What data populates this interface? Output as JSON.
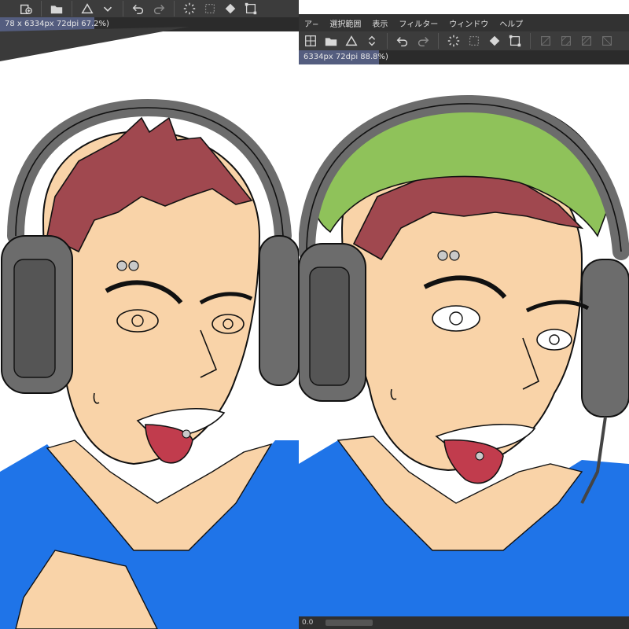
{
  "colors": {
    "hair": "#a0484f",
    "skin": "#f9d3a8",
    "shirt": "#1f74e8",
    "bandana": "#8fc25a",
    "headphones": "#6c6c6c",
    "tongue": "#c13c4d",
    "ui_dark": "#3c3c3c",
    "tab_active": "#545d7f"
  },
  "left_window": {
    "tab_label": "78 x 6334px 72dpi 67.2%)",
    "toolbar_icons": [
      "new-layer-icon",
      "folder-open-icon",
      "triangle-icon",
      "chevron-down-icon",
      "undo-icon",
      "redo-icon",
      "spinner-icon",
      "grid-icon",
      "fill-icon",
      "transform-icon"
    ]
  },
  "right_window": {
    "menu_items": [
      "ア−",
      "選択範囲",
      "表示",
      "フィルター",
      "ウィンドウ",
      "ヘルプ"
    ],
    "tab_label": "6334px 72dpi 88.8%)",
    "toolbar_icons": [
      "grid-icon",
      "folder-open-icon",
      "triangle-icon",
      "stepper-icon",
      "undo-icon",
      "redo-icon",
      "spinner-icon",
      "grid-icon",
      "fill-icon",
      "transform-icon",
      "hatch-icon",
      "hatch-icon",
      "hatch-icon",
      "hatch-icon"
    ],
    "status_value": "0.0"
  }
}
